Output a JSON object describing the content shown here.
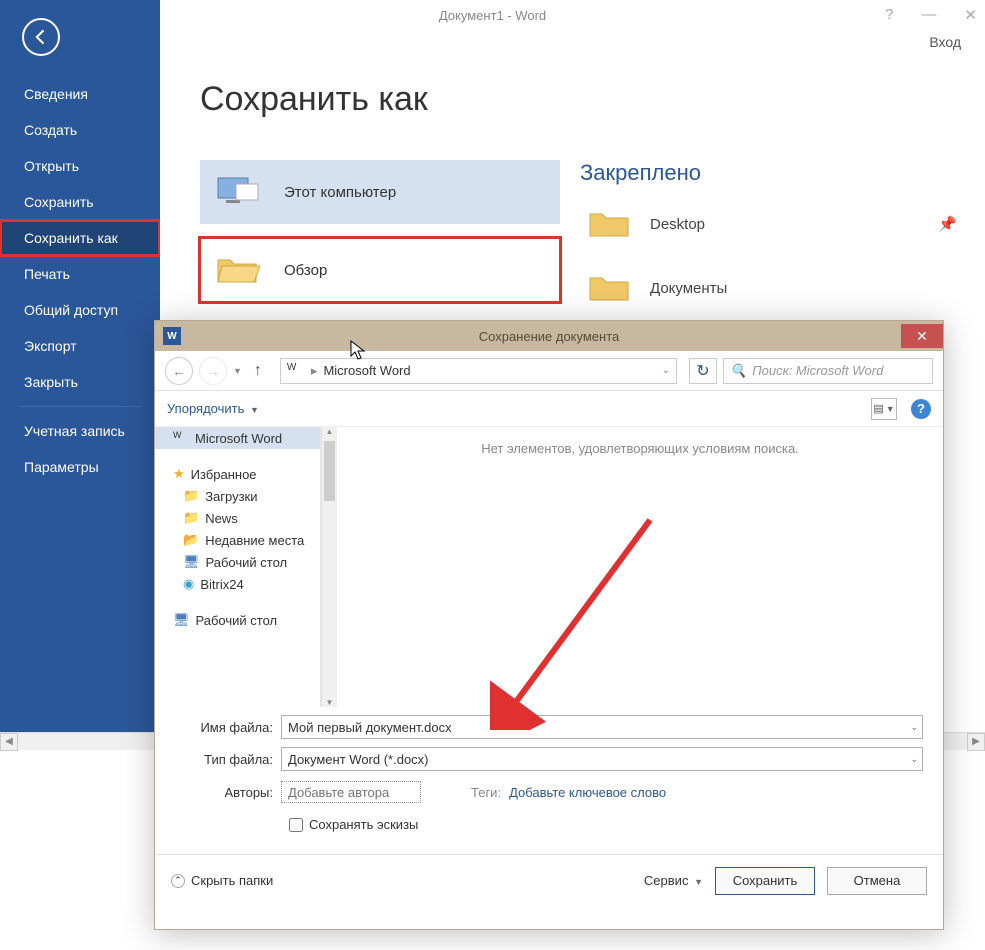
{
  "titlebar": {
    "title": "Документ1 - Word",
    "login": "Вход"
  },
  "sidebar": {
    "items": [
      "Сведения",
      "Создать",
      "Открыть",
      "Сохранить",
      "Сохранить как",
      "Печать",
      "Общий доступ",
      "Экспорт",
      "Закрыть"
    ],
    "account": "Учетная запись",
    "options": "Параметры"
  },
  "main": {
    "title": "Сохранить как",
    "this_pc": "Этот компьютер",
    "browse": "Обзор",
    "pinned_label": "Закреплено",
    "pinned": [
      "Desktop",
      "Документы"
    ]
  },
  "dialog": {
    "title": "Сохранение документа",
    "path": "Microsoft Word",
    "search_placeholder": "Поиск: Microsoft Word",
    "organize": "Упорядочить",
    "empty_message": "Нет элементов, удовлетворяющих условиям поиска.",
    "tree": {
      "root": "Microsoft Word",
      "fav": "Избранное",
      "items": [
        "Загрузки",
        "News",
        "Недавние места",
        "Рабочий стол",
        "Bitrix24"
      ],
      "desk": "Рабочий стол"
    },
    "filename_label": "Имя файла:",
    "filename_value": "Мой первый документ.docx",
    "filetype_label": "Тип файла:",
    "filetype_value": "Документ Word (*.docx)",
    "authors_label": "Авторы:",
    "authors_placeholder": "Добавьте автора",
    "tags_label": "Теги:",
    "tags_value": "Добавьте ключевое слово",
    "thumbnail_checkbox": "Сохранять эскизы",
    "hide_folders": "Скрыть папки",
    "service": "Сервис",
    "save": "Сохранить",
    "cancel": "Отмена"
  }
}
